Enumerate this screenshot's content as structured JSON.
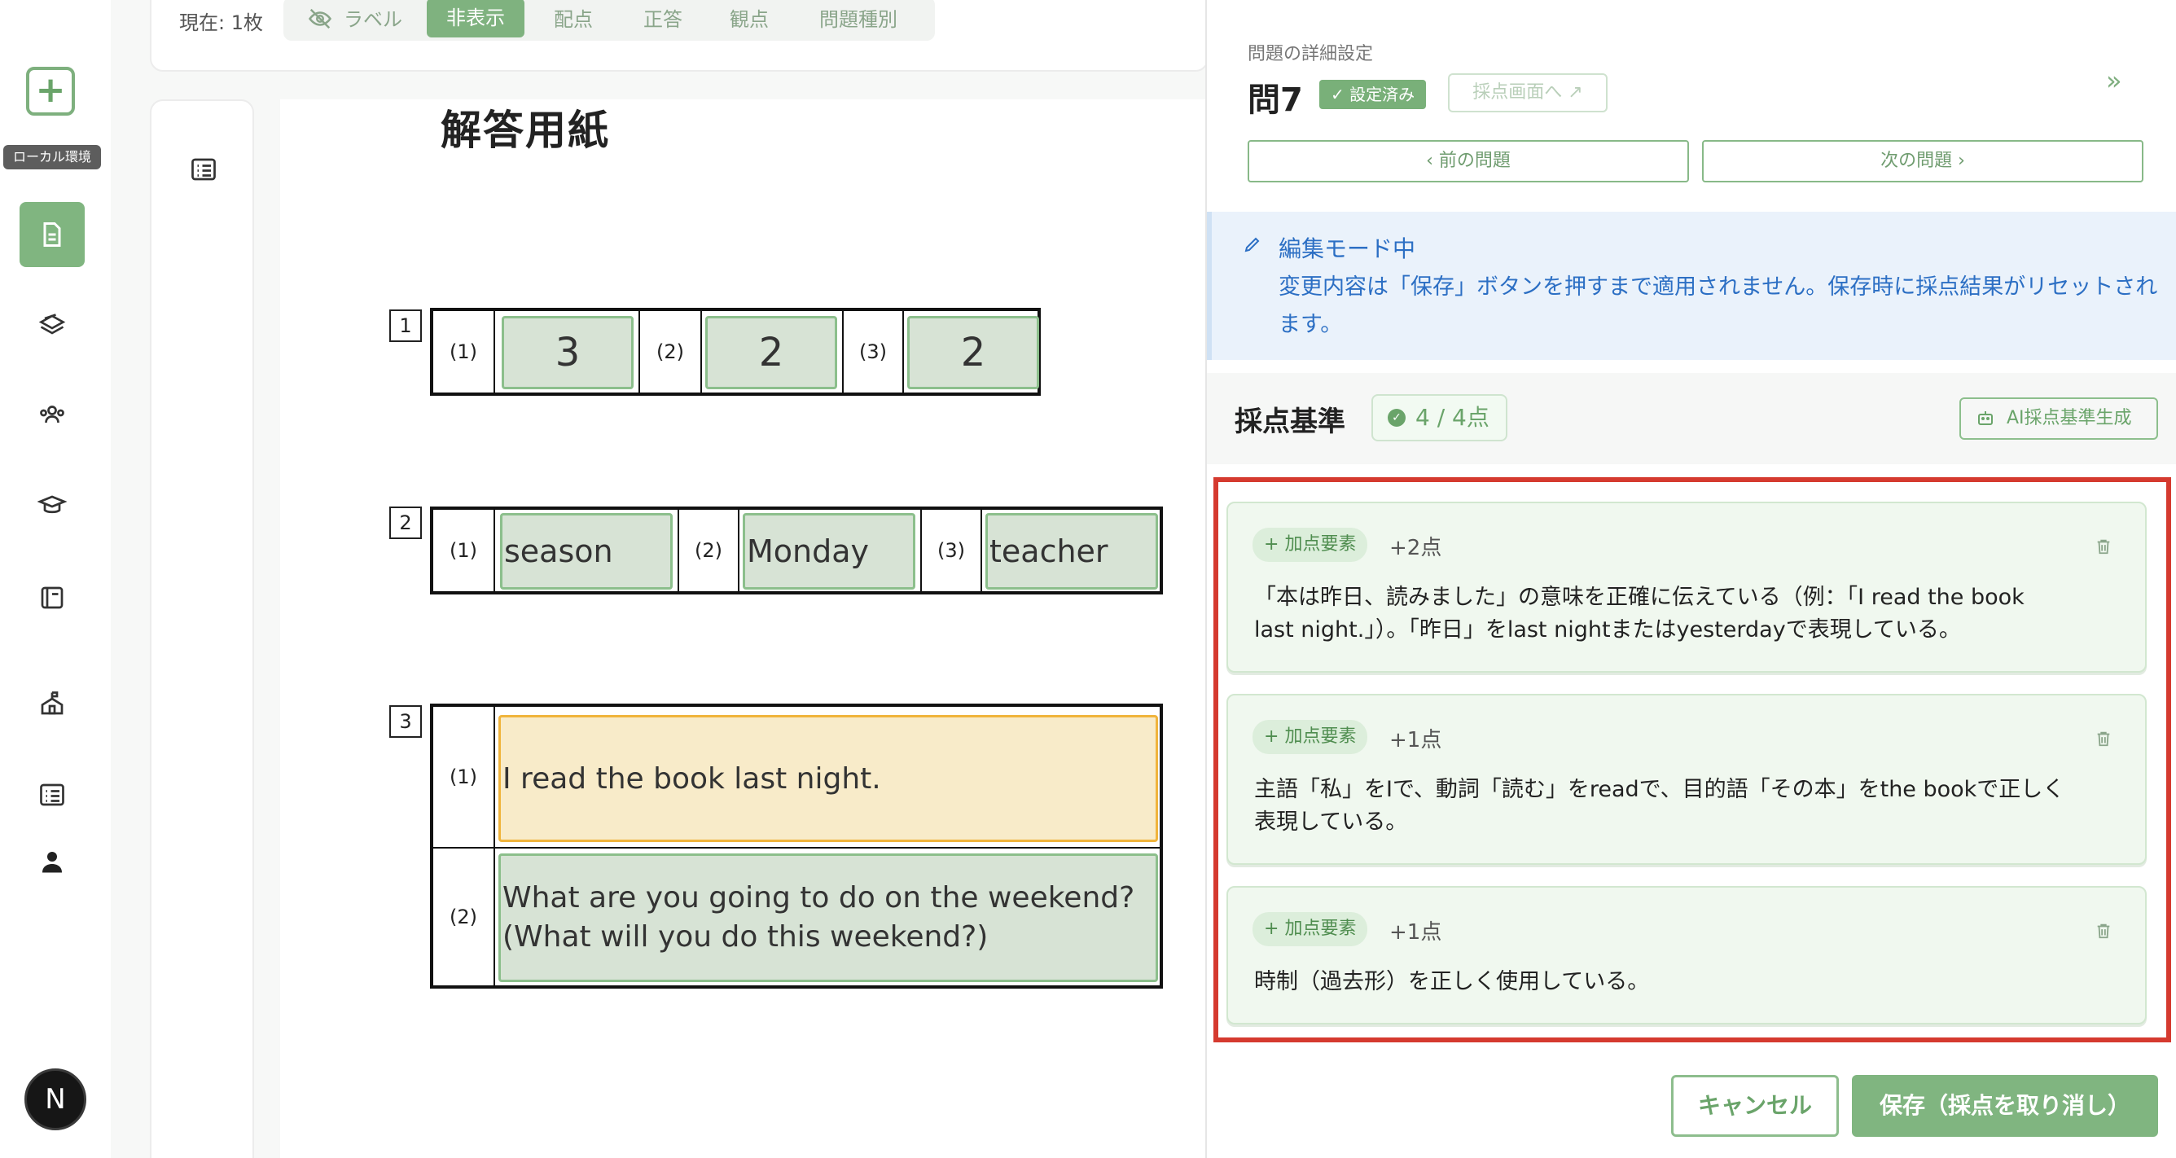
{
  "rail": {
    "env_label": "ローカル環境",
    "avatar_letter": "N",
    "items": [
      "document-icon",
      "stack-icon",
      "group-icon",
      "graduation-icon",
      "book-icon",
      "school-icon",
      "list-icon",
      "user-icon"
    ]
  },
  "toolbar": {
    "current": "現在: 1枚",
    "options": [
      "ラベル",
      "非表示",
      "配点",
      "正答",
      "観点",
      "問題種別"
    ],
    "selected": "非表示"
  },
  "sheet": {
    "title": "解答用紙",
    "q1": {
      "num": "1",
      "labels": [
        "(1)",
        "(2)",
        "(3)"
      ],
      "answers": [
        "3",
        "2",
        "2"
      ]
    },
    "q2": {
      "num": "2",
      "labels": [
        "(1)",
        "(2)",
        "(3)"
      ],
      "answers": [
        "season",
        "Monday",
        "teacher"
      ]
    },
    "q3": {
      "num": "3",
      "labels": [
        "(1)",
        "(2)"
      ],
      "answers": [
        "I read the book last night.",
        "What are you going to do on the weekend?",
        "(What will you do this weekend?)"
      ]
    }
  },
  "panel": {
    "crumb": "問題の詳細設定",
    "title": "問7",
    "status": "設定済み",
    "goto": "採点画面へ",
    "prev": "前の問題",
    "next": "次の問題",
    "edit_head": "編集モード中",
    "edit_text": "変更内容は「保存」ボタンを押すまで適用されません。保存時に採点結果がリセットされます。",
    "section": "採点基準",
    "points": "4 / 4点",
    "ai_button": "AI採点基準生成",
    "criteria": [
      {
        "tag": "加点要素",
        "score": "+2点",
        "text": "「本は昨日、読みました」の意味を正確に伝えている（例：「I read the book last night.」）。「昨日」をlast nightまたはyesterdayで表現している。"
      },
      {
        "tag": "加点要素",
        "score": "+1点",
        "text": "主語「私」をIで、動詞「読む」をreadで、目的語「その本」をthe bookで正しく表現している。"
      },
      {
        "tag": "加点要素",
        "score": "+1点",
        "text": "時制（過去形）を正しく使用している。"
      }
    ],
    "cancel": "キャンセル",
    "save": "保存（採点を取り消し）"
  },
  "colors": {
    "accent": "#80b580",
    "edit_blue": "#2c6fc4",
    "highlight": "#d53a2f"
  }
}
